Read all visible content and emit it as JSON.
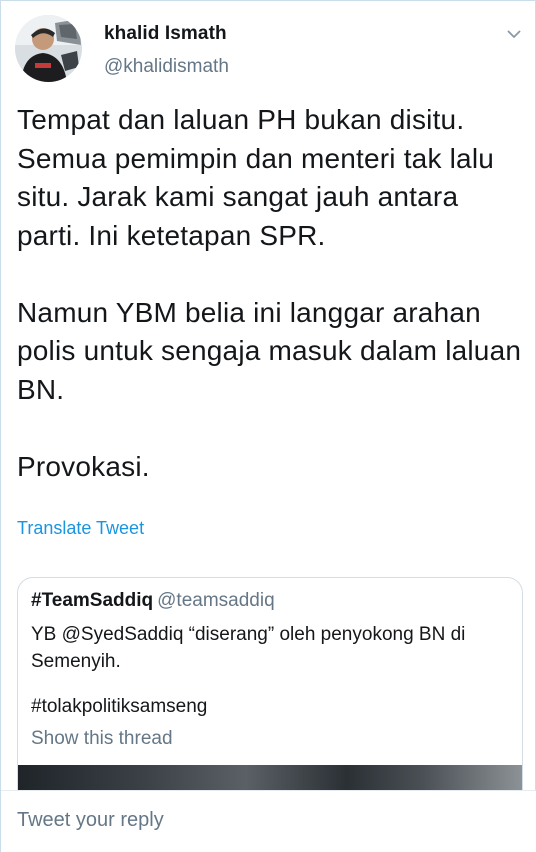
{
  "tweet": {
    "author": {
      "display_name": "khalid Ismath",
      "handle": "@khalidismath"
    },
    "text": "Tempat dan laluan PH bukan disitu. Semua pemimpin dan menteri tak lalu situ. Jarak kami sangat jauh antara parti. Ini ketetapan SPR.\n\nNamun YBM belia ini langgar arahan polis untuk sengaja masuk dalam laluan BN.\n\nProvokasi.",
    "translate_label": "Translate Tweet"
  },
  "quoted_tweet": {
    "display_name": "#TeamSaddiq",
    "handle": "@teamsaddiq",
    "text": "YB @SyedSaddiq “diserang” oleh penyokong BN di Semenyih.",
    "hashtag": "#tolakpolitiksamseng",
    "show_thread_label": "Show this thread"
  },
  "reply": {
    "placeholder": "Tweet your reply"
  },
  "icons": {
    "menu": "chevron-down-icon",
    "avatar": "profile-photo"
  },
  "colors": {
    "link": "#1b95e0",
    "secondary_text": "#657786",
    "primary_text": "#14171a",
    "border": "#c9ddea"
  }
}
